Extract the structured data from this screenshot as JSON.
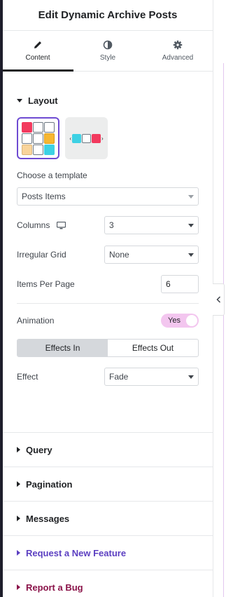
{
  "header": {
    "title": "Edit Dynamic Archive Posts"
  },
  "tabs": [
    {
      "label": "Content",
      "icon": "pencil-icon",
      "active": true
    },
    {
      "label": "Style",
      "icon": "half-circle-icon",
      "active": false
    },
    {
      "label": "Advanced",
      "icon": "gear-icon",
      "active": false
    }
  ],
  "layout": {
    "title": "Layout",
    "template_label": "Choose a template",
    "template_value": "Posts Items",
    "columns_label": "Columns",
    "columns_value": "3",
    "irregular_label": "Irregular Grid",
    "irregular_value": "None",
    "per_page_label": "Items Per Page",
    "per_page_value": "6",
    "animation_label": "Animation",
    "animation_value": "Yes",
    "effects_in_label": "Effects In",
    "effects_out_label": "Effects Out",
    "effect_label": "Effect",
    "effect_value": "Fade"
  },
  "sections": {
    "query": "Query",
    "pagination": "Pagination",
    "messages": "Messages",
    "feature": "Request a New Feature",
    "bug": "Report a Bug"
  },
  "colors": {
    "accent_purple": "#6e4bd2",
    "feature_purple": "#5b3fc1",
    "bug_maroon": "#8a1349",
    "toggle_pink": "#f3c6ef",
    "tile_red": "#f23a5e",
    "tile_orange": "#f7b731",
    "tile_peach": "#f9d49b",
    "tile_cyan": "#3dd1e4"
  }
}
